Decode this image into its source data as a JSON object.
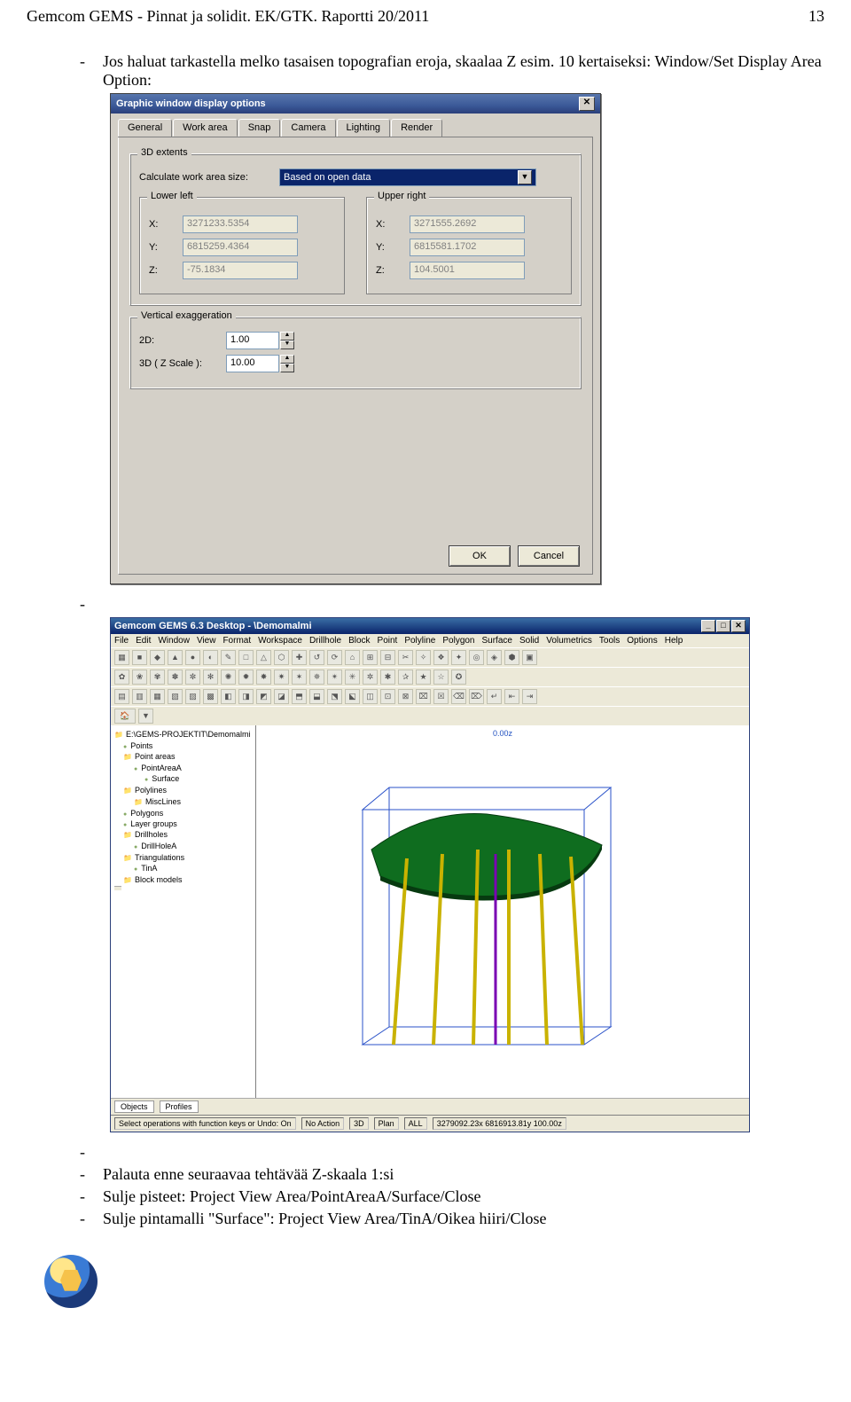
{
  "header": {
    "left": "Gemcom GEMS - Pinnat ja solidit. EK/GTK. Raportti 20/2011",
    "page_number": "13"
  },
  "intro": {
    "line": "Jos haluat tarkastella melko tasaisen topografian eroja, skaalaa Z esim. 10 kertaiseksi: Window/Set Display Area Option:"
  },
  "dialog": {
    "title": "Graphic window display options",
    "tabs": [
      "General",
      "Work area",
      "Snap",
      "Camera",
      "Lighting",
      "Render"
    ],
    "active_tab": "Work area",
    "extents_group": "3D extents",
    "calc_label": "Calculate work area size:",
    "calc_value": "Based on open data",
    "lower_left": "Lower left",
    "upper_right": "Upper right",
    "ll": {
      "x": "3271233.5354",
      "y": "6815259.4364",
      "z": "-75.1834"
    },
    "ur": {
      "x": "3271555.2692",
      "y": "6815581.1702",
      "z": "104.5001"
    },
    "axis_x": "X:",
    "axis_y": "Y:",
    "axis_z": "Z:",
    "vexag_group": "Vertical exaggeration",
    "twod_label": "2D:",
    "twod_value": "1.00",
    "threed_label": "3D ( Z Scale ):",
    "threed_value": "10.00",
    "ok": "OK",
    "cancel": "Cancel"
  },
  "app": {
    "title": "Gemcom GEMS 6.3 Desktop - \\Demomalmi",
    "menu": [
      "File",
      "Edit",
      "Window",
      "View",
      "Format",
      "Workspace",
      "Drillhole",
      "Block",
      "Point",
      "Polyline",
      "Polygon",
      "Surface",
      "Solid",
      "Volumetrics",
      "Tools",
      "Options",
      "Help"
    ],
    "tree": {
      "root": "E:\\GEMS-PROJEKTIT\\Demomalmi",
      "items": [
        {
          "lvl": 1,
          "txt": "Points"
        },
        {
          "lvl": 1,
          "txt": "Point areas"
        },
        {
          "lvl": 2,
          "txt": "PointAreaA"
        },
        {
          "lvl": 3,
          "txt": "Surface"
        },
        {
          "lvl": 1,
          "txt": "Polylines"
        },
        {
          "lvl": 2,
          "txt": "MiscLines"
        },
        {
          "lvl": 1,
          "txt": "Polygons"
        },
        {
          "lvl": 1,
          "txt": "Layer groups"
        },
        {
          "lvl": 1,
          "txt": "Drillholes"
        },
        {
          "lvl": 2,
          "txt": "DrillHoleA"
        },
        {
          "lvl": 1,
          "txt": "Triangulations"
        },
        {
          "lvl": 2,
          "txt": "TinA"
        },
        {
          "lvl": 1,
          "txt": "Block models"
        }
      ],
      "bottom_tabs": [
        "Objects",
        "Profiles"
      ]
    },
    "axis_top": "0.00z",
    "status": {
      "sel": "Select operations with function keys or Undo: On",
      "action": "No Action",
      "mode3d": "3D",
      "plan": "Plan",
      "all": "ALL",
      "coords": "3279092.23x 6816913.81y 100.00z"
    }
  },
  "bullets": {
    "b1": "Palauta enne seuraavaa tehtävää Z-skaala 1:si",
    "b2": "Sulje pisteet: Project View Area/PointAreaA/Surface/Close",
    "b3": "Sulje pintamalli \"Surface\": Project View Area/TinA/Oikea hiiri/Close"
  }
}
